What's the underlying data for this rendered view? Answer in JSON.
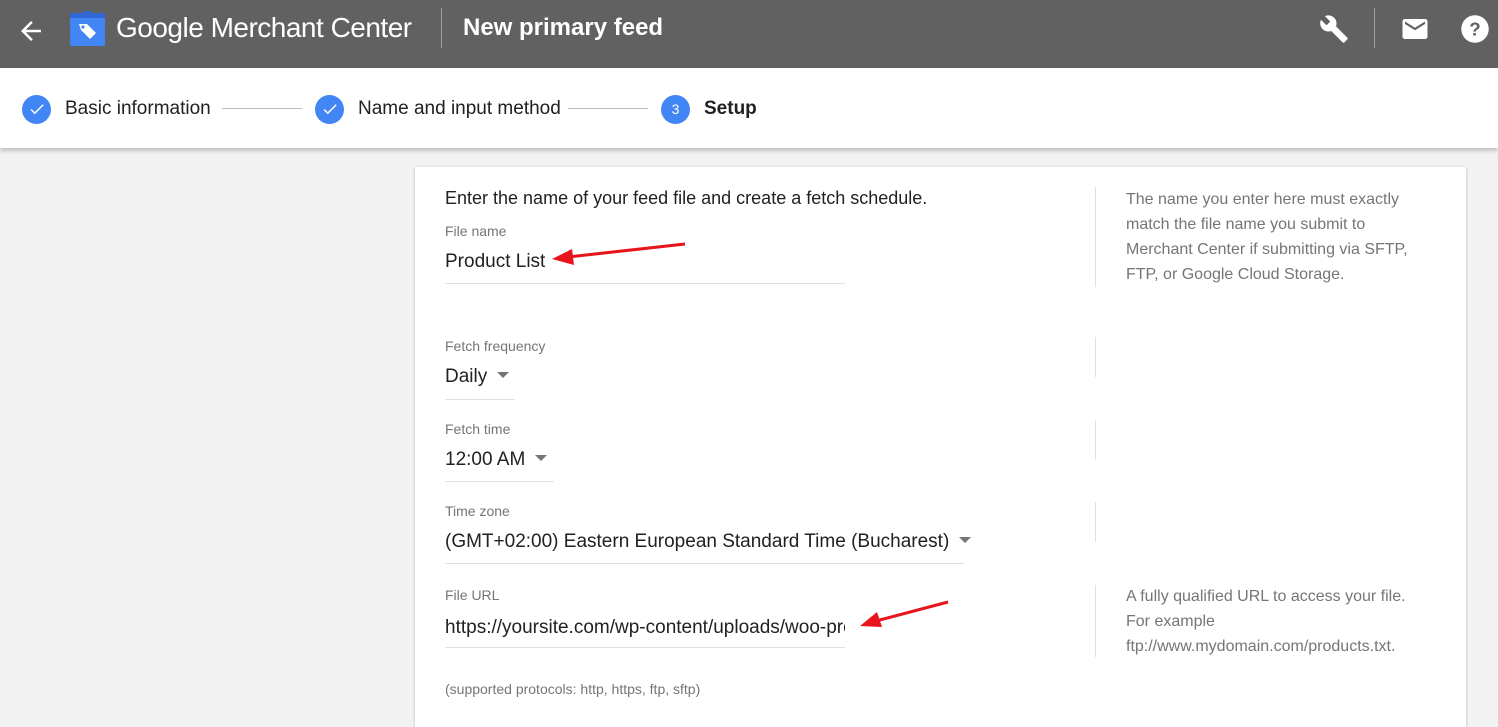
{
  "header": {
    "app_name": "Google Merchant Center",
    "page_title": "New primary feed",
    "icons": [
      "back-arrow-icon",
      "merchant-center-logo",
      "wrench-icon",
      "mail-icon",
      "help-icon"
    ]
  },
  "stepper": {
    "steps": [
      {
        "label": "Basic information",
        "status": "complete",
        "marker": "✓"
      },
      {
        "label": "Name and input method",
        "status": "complete",
        "marker": "✓"
      },
      {
        "label": "Setup",
        "status": "active",
        "marker": "3"
      }
    ]
  },
  "form": {
    "intro": "Enter the name of your feed file and create a fetch schedule.",
    "file_name": {
      "label": "File name",
      "value": "Product List"
    },
    "file_name_help": "The name you enter here must exactly match the file name you submit to Merchant Center if submitting via SFTP, FTP, or Google Cloud Storage.",
    "fetch_frequency": {
      "label": "Fetch frequency",
      "value": "Daily"
    },
    "fetch_time": {
      "label": "Fetch time",
      "value": "12:00 AM"
    },
    "time_zone": {
      "label": "Time zone",
      "value": "(GMT+02:00) Eastern European Standard Time (Bucharest)"
    },
    "file_url": {
      "label": "File URL",
      "value": "https://yoursite.com/wp-content/uploads/woo-product-feed"
    },
    "file_url_help_line1": "A fully qualified URL to access your file.",
    "file_url_help_line2": "For example",
    "file_url_help_line3": "ftp://www.mydomain.com/products.txt.",
    "protocols_note": "(supported protocols: http, https, ftp, sftp)"
  },
  "annotations": {
    "arrow_color": "#e8141b"
  },
  "colors": {
    "header_bg": "#616161",
    "step_blue": "#4285f4"
  }
}
